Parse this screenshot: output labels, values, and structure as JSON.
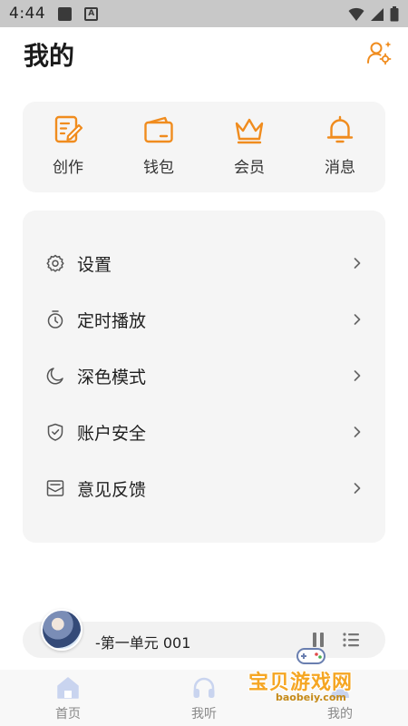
{
  "status_bar": {
    "time": "4:44"
  },
  "header": {
    "title": "我的"
  },
  "quick_actions": [
    {
      "label": "创作",
      "icon": "create-icon"
    },
    {
      "label": "钱包",
      "icon": "wallet-icon"
    },
    {
      "label": "会员",
      "icon": "crown-icon"
    },
    {
      "label": "消息",
      "icon": "bell-icon"
    }
  ],
  "menu": [
    {
      "label": "设置",
      "icon": "gear-icon"
    },
    {
      "label": "定时播放",
      "icon": "timer-icon"
    },
    {
      "label": "深色模式",
      "icon": "moon-icon"
    },
    {
      "label": "账户安全",
      "icon": "shield-icon"
    },
    {
      "label": "意见反馈",
      "icon": "mail-icon"
    }
  ],
  "player": {
    "track_title": "-第一单元 001"
  },
  "bottom_nav": [
    {
      "label": "首页",
      "icon": "home-icon"
    },
    {
      "label": "我听",
      "icon": "headphones-icon"
    },
    {
      "label": "我的",
      "icon": "profile-icon"
    }
  ],
  "watermark": {
    "text": "宝贝游戏网",
    "url": "baobeiy.com"
  },
  "colors": {
    "accent": "#f08c1e",
    "card_bg": "#f5f5f5",
    "nav_icon": "#c9d4ef"
  }
}
